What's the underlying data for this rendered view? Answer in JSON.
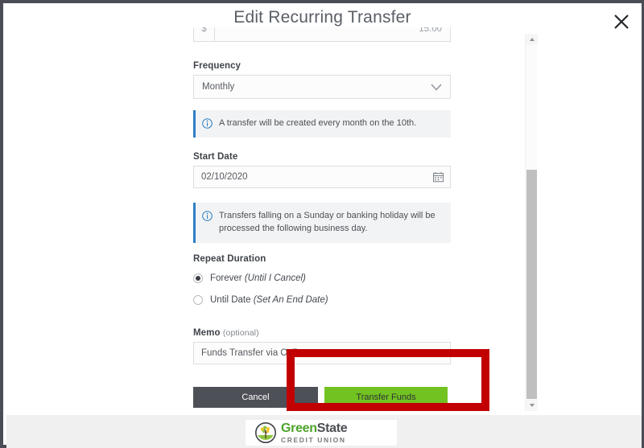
{
  "modal": {
    "title": "Edit Recurring Transfer",
    "close_icon": "close-icon"
  },
  "amount_field": {
    "prefix": "$",
    "value": "15.00"
  },
  "frequency": {
    "label": "Frequency",
    "value": "Monthly",
    "chevron_icon": "chevron-down-icon"
  },
  "frequency_notice": {
    "icon": "info-circle-icon",
    "text": "A transfer will be created every month on the 10th."
  },
  "start_date": {
    "label": "Start Date",
    "value": "02/10/2020",
    "calendar_icon": "calendar-icon"
  },
  "holiday_notice": {
    "icon": "info-circle-icon",
    "line1": "Transfers falling on a Sunday or banking holiday will be processed",
    "line2": "the following business day."
  },
  "repeat_duration": {
    "label": "Repeat Duration",
    "options": [
      {
        "label": "Forever ",
        "emphasis": "(Until I Cancel)",
        "selected": true
      },
      {
        "label": "Until Date ",
        "emphasis": "(Set An End Date)",
        "selected": false
      }
    ]
  },
  "memo": {
    "label": "Memo ",
    "optional_suffix": "(optional)",
    "value": "Funds Transfer via Online"
  },
  "actions": {
    "cancel_label": "Cancel",
    "submit_label": "Transfer Funds"
  },
  "annotation": {
    "color": "#c20000",
    "target": "Transfer Funds"
  },
  "scrollbar": {
    "up_icon": "scroll-up-arrow-icon",
    "down_icon": "scroll-down-arrow-icon"
  },
  "footer": {
    "logo_name_part1": "Green",
    "logo_name_part2": "State",
    "logo_subtitle": "CREDIT UNION",
    "emblem_icon": "tree-circle-logo-icon",
    "brand_green": "#4ca32b",
    "brand_gray": "#4b4f54"
  }
}
